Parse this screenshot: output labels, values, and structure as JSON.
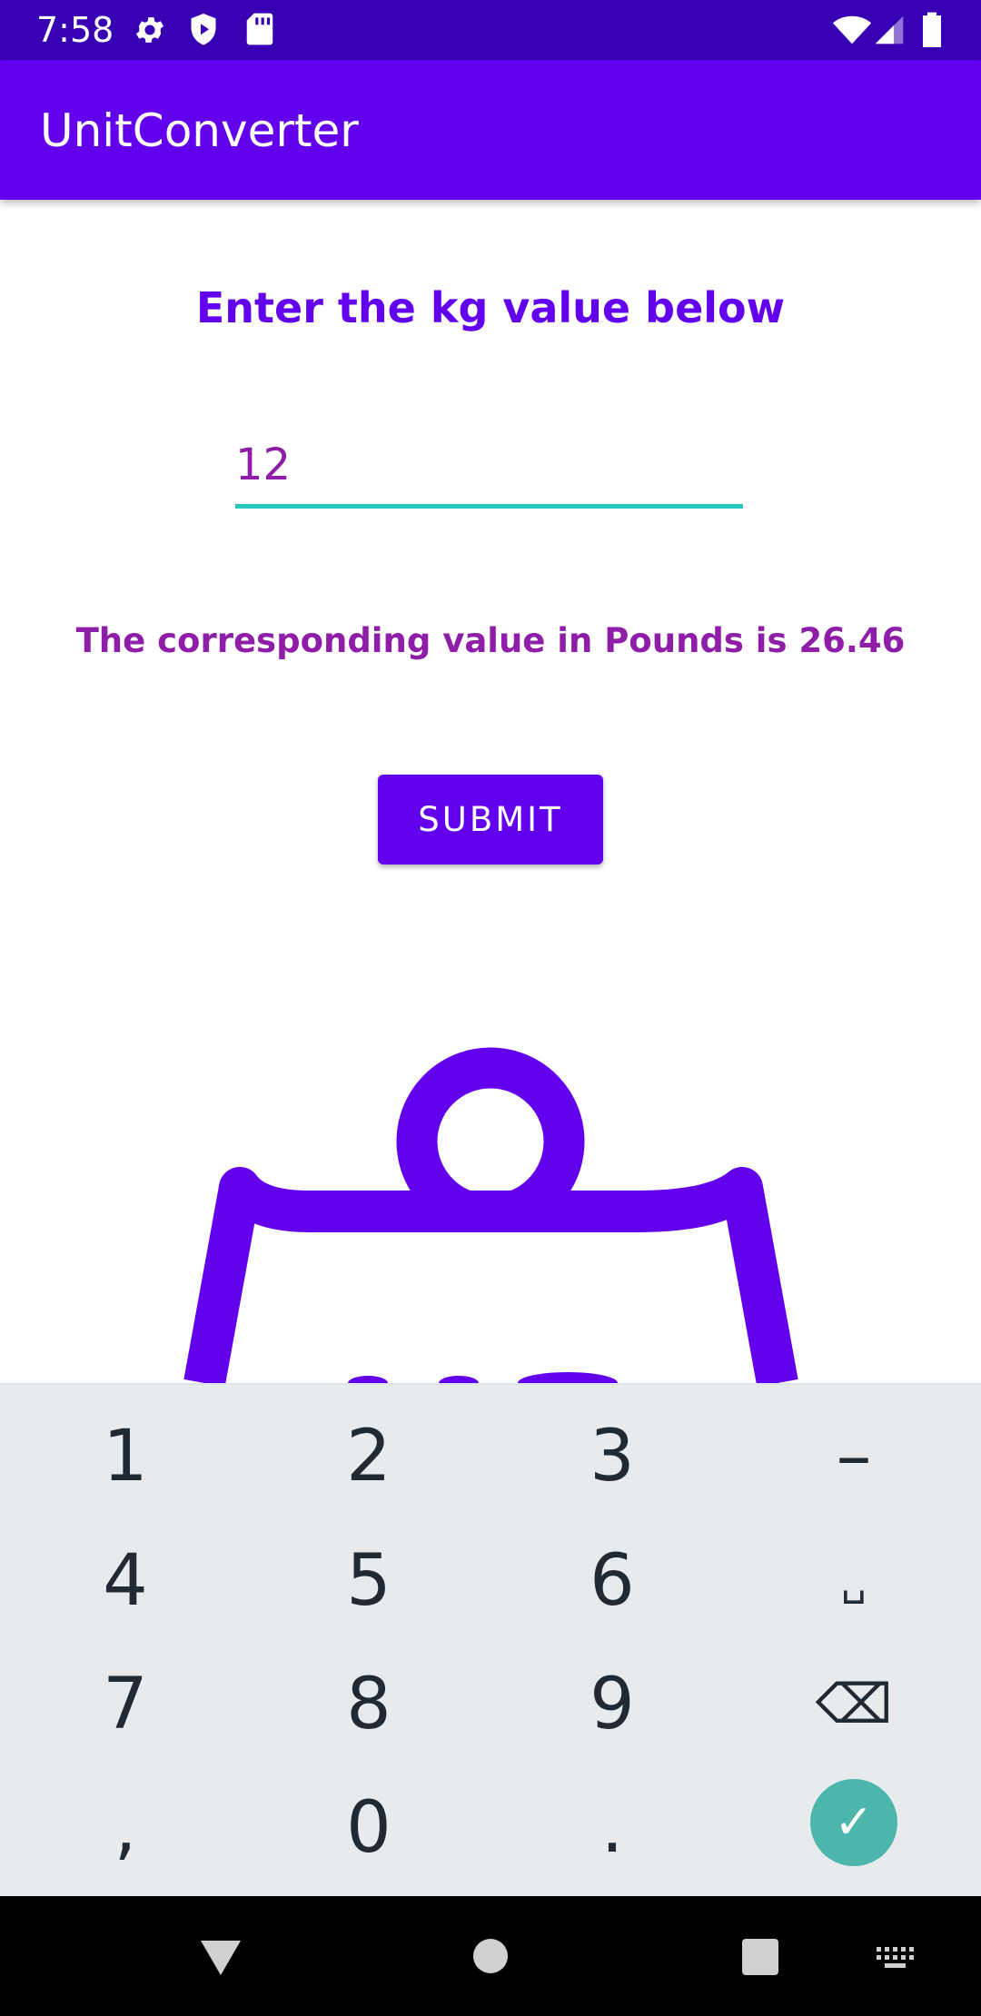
{
  "status_bar": {
    "time": "7:58",
    "left_icons": [
      "gear-icon",
      "shield-play-icon",
      "sd-card-icon"
    ],
    "right_icons": [
      "wifi-icon",
      "cellular-signal-icon",
      "battery-icon"
    ]
  },
  "app_bar": {
    "title": "UnitConverter",
    "color": "#6200ee"
  },
  "main": {
    "prompt": "Enter the kg value below",
    "input_value": "12",
    "result": "The corresponding value in Pounds is 26.46",
    "submit_label": "SUBMIT",
    "image_icon": "kettlebell-weight-icon"
  },
  "keyboard": {
    "rows": [
      [
        "1",
        "2",
        "3",
        "–"
      ],
      [
        "4",
        "5",
        "6",
        "␣"
      ],
      [
        "7",
        "8",
        "9",
        "⌫"
      ],
      [
        ",",
        "0",
        ".",
        "✓"
      ]
    ],
    "enter_color": "#4db6ac"
  },
  "nav_bar": {
    "icons": [
      "back-icon",
      "home-icon",
      "recents-icon",
      "keyboard-switch-icon"
    ]
  }
}
